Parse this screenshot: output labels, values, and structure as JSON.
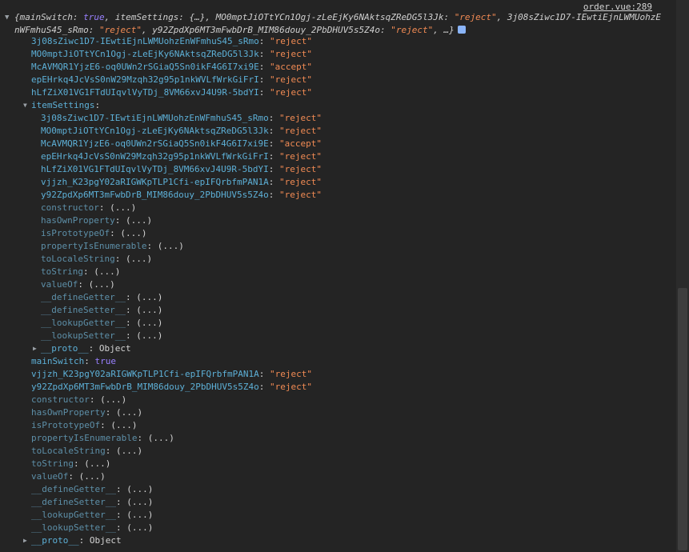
{
  "source_link": "order.vue:289",
  "summary": {
    "text_parts": [
      {
        "k": "{mainSwitch: ",
        "t": "plain"
      },
      {
        "k": "true",
        "t": "bool"
      },
      {
        "k": ", itemSettings: {…}, MO0mptJiOTtYCn1Ogj-zLeEjKy6NAktsqZReDG5l3Jk: ",
        "t": "plain"
      },
      {
        "k": "\"reject\"",
        "t": "str"
      },
      {
        "k": ", 3j08sZiwc1D7-IEwtiEjnLWMUohzEnWFmhuS45_sRmo: ",
        "t": "plain"
      },
      {
        "k": "\"reject\"",
        "t": "str"
      },
      {
        "k": ", y92ZpdXp6MT3mFwbDrB_MIM86douy_2PbDHUV5s5Z4o: ",
        "t": "plain"
      },
      {
        "k": "\"reject\"",
        "t": "str"
      },
      {
        "k": ", …}",
        "t": "plain"
      }
    ]
  },
  "rows": [
    {
      "indent": 39,
      "key": "3j08sZiwc1D7-IEwtiEjnLWMUohzEnWFmhuS45_sRmo",
      "val": "\"reject\"",
      "type": "str"
    },
    {
      "indent": 39,
      "key": "MO0mptJiOTtYCn1Ogj-zLeEjKy6NAktsqZReDG5l3Jk",
      "val": "\"reject\"",
      "type": "str"
    },
    {
      "indent": 39,
      "key": "McAVMQR1YjzE6-oq0UWn2rSGiaQ5Sn0ikF4G6I7xi9E",
      "val": "\"accept\"",
      "type": "str"
    },
    {
      "indent": 39,
      "key": "epEHrkq4JcVsS0nW29Mzqh32g95p1nkWVLfWrkGiFrI",
      "val": "\"reject\"",
      "type": "str"
    },
    {
      "indent": 39,
      "key": "hLfZiX01VG1FTdUIqvlVyTDj_8VM66xvJ4U9R-5bdYI",
      "val": "\"reject\"",
      "type": "str"
    },
    {
      "indent": 39,
      "key": "itemSettings",
      "val": "",
      "type": "expanded"
    },
    {
      "indent": 51,
      "key": "3j08sZiwc1D7-IEwtiEjnLWMUohzEnWFmhuS45_sRmo",
      "val": "\"reject\"",
      "type": "str"
    },
    {
      "indent": 51,
      "key": "MO0mptJiOTtYCn1Ogj-zLeEjKy6NAktsqZReDG5l3Jk",
      "val": "\"reject\"",
      "type": "str"
    },
    {
      "indent": 51,
      "key": "McAVMQR1YjzE6-oq0UWn2rSGiaQ5Sn0ikF4G6I7xi9E",
      "val": "\"accept\"",
      "type": "str"
    },
    {
      "indent": 51,
      "key": "epEHrkq4JcVsS0nW29Mzqh32g95p1nkWVLfWrkGiFrI",
      "val": "\"reject\"",
      "type": "str"
    },
    {
      "indent": 51,
      "key": "hLfZiX01VG1FTdUIqvlVyTDj_8VM66xvJ4U9R-5bdYI",
      "val": "\"reject\"",
      "type": "str"
    },
    {
      "indent": 51,
      "key": "vjjzh_K23pgY02aRIGWKpTLP1Cfi-epIFQrbfmPAN1A",
      "val": "\"reject\"",
      "type": "str"
    },
    {
      "indent": 51,
      "key": "y92ZpdXp6MT3mFwbDrB_MIM86douy_2PbDHUV5s5Z4o",
      "val": "\"reject\"",
      "type": "str"
    },
    {
      "indent": 51,
      "key": "constructor",
      "val": "(...)",
      "type": "dim"
    },
    {
      "indent": 51,
      "key": "hasOwnProperty",
      "val": "(...)",
      "type": "dim"
    },
    {
      "indent": 51,
      "key": "isPrototypeOf",
      "val": "(...)",
      "type": "dim"
    },
    {
      "indent": 51,
      "key": "propertyIsEnumerable",
      "val": "(...)",
      "type": "dim"
    },
    {
      "indent": 51,
      "key": "toLocaleString",
      "val": "(...)",
      "type": "dim"
    },
    {
      "indent": 51,
      "key": "toString",
      "val": "(...)",
      "type": "dim"
    },
    {
      "indent": 51,
      "key": "valueOf",
      "val": "(...)",
      "type": "dim"
    },
    {
      "indent": 51,
      "key": "__defineGetter__",
      "val": "(...)",
      "type": "dim"
    },
    {
      "indent": 51,
      "key": "__defineSetter__",
      "val": "(...)",
      "type": "dim"
    },
    {
      "indent": 51,
      "key": "__lookupGetter__",
      "val": "(...)",
      "type": "dim"
    },
    {
      "indent": 51,
      "key": "__lookupSetter__",
      "val": "(...)",
      "type": "dim"
    },
    {
      "indent": 51,
      "key": "__proto__",
      "val": "Object",
      "type": "collapsed"
    },
    {
      "indent": 39,
      "key": "mainSwitch",
      "val": "true",
      "type": "bool"
    },
    {
      "indent": 39,
      "key": "vjjzh_K23pgY02aRIGWKpTLP1Cfi-epIFQrbfmPAN1A",
      "val": "\"reject\"",
      "type": "str"
    },
    {
      "indent": 39,
      "key": "y92ZpdXp6MT3mFwbDrB_MIM86douy_2PbDHUV5s5Z4o",
      "val": "\"reject\"",
      "type": "str"
    },
    {
      "indent": 39,
      "key": "constructor",
      "val": "(...)",
      "type": "dim"
    },
    {
      "indent": 39,
      "key": "hasOwnProperty",
      "val": "(...)",
      "type": "dim"
    },
    {
      "indent": 39,
      "key": "isPrototypeOf",
      "val": "(...)",
      "type": "dim"
    },
    {
      "indent": 39,
      "key": "propertyIsEnumerable",
      "val": "(...)",
      "type": "dim"
    },
    {
      "indent": 39,
      "key": "toLocaleString",
      "val": "(...)",
      "type": "dim"
    },
    {
      "indent": 39,
      "key": "toString",
      "val": "(...)",
      "type": "dim"
    },
    {
      "indent": 39,
      "key": "valueOf",
      "val": "(...)",
      "type": "dim"
    },
    {
      "indent": 39,
      "key": "__defineGetter__",
      "val": "(...)",
      "type": "dim"
    },
    {
      "indent": 39,
      "key": "__defineSetter__",
      "val": "(...)",
      "type": "dim"
    },
    {
      "indent": 39,
      "key": "__lookupGetter__",
      "val": "(...)",
      "type": "dim"
    },
    {
      "indent": 39,
      "key": "__lookupSetter__",
      "val": "(...)",
      "type": "dim"
    },
    {
      "indent": 39,
      "key": "__proto__",
      "val": "Object",
      "type": "collapsed"
    }
  ],
  "colors": {
    "background": "#242424",
    "key": "#5db0d7",
    "string": "#f28b54",
    "boolean": "#9980ff"
  }
}
